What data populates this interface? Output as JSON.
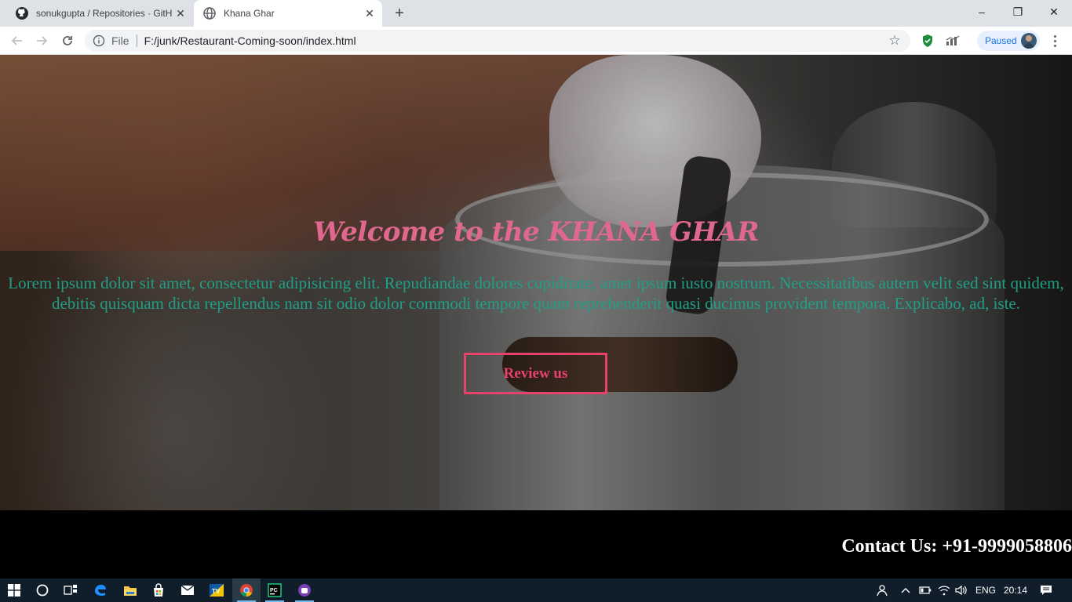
{
  "browser": {
    "tabs": [
      {
        "title": "sonukgupta / Repositories · GitHub",
        "favicon": "github-icon",
        "active": false
      },
      {
        "title": "Khana Ghar",
        "favicon": "globe-icon",
        "active": true
      }
    ],
    "new_tab_label": "+",
    "window_controls": {
      "minimize": "–",
      "restore": "❐",
      "close": "✕"
    },
    "address": {
      "scheme": "File",
      "url": "F:/junk/Restaurant-Coming-soon/index.html"
    },
    "profile_label": "Paused"
  },
  "page": {
    "heading": "Welcome to the KHANA GHAR",
    "paragraph": "Lorem ipsum dolor sit amet, consectetur adipisicing elit. Repudiandae dolores cupiditate, amet ipsum iusto nostrum. Necessitatibus autem velit sed sint quidem, debitis quisquam dicta repellendus nam sit odio dolor commodi tempore quam reprehenderit quasi ducimus provident tempora. Explicabo, ad, iste.",
    "review_button": "Review us",
    "contact": "Contact Us: +91-9999058806",
    "colors": {
      "heading": "#e0688e",
      "paragraph": "#1f9f86",
      "button": "#e8416c",
      "footer_bg": "#000000"
    }
  },
  "taskbar": {
    "apps": [
      "start-icon",
      "cortana-icon",
      "task-view-icon",
      "edge-icon",
      "file-explorer-icon",
      "store-icon",
      "mail-icon",
      "teamviewer-icon",
      "chrome-icon",
      "pycharm-icon",
      "extra-app-icon"
    ],
    "language": "ENG",
    "time": "20:14"
  }
}
